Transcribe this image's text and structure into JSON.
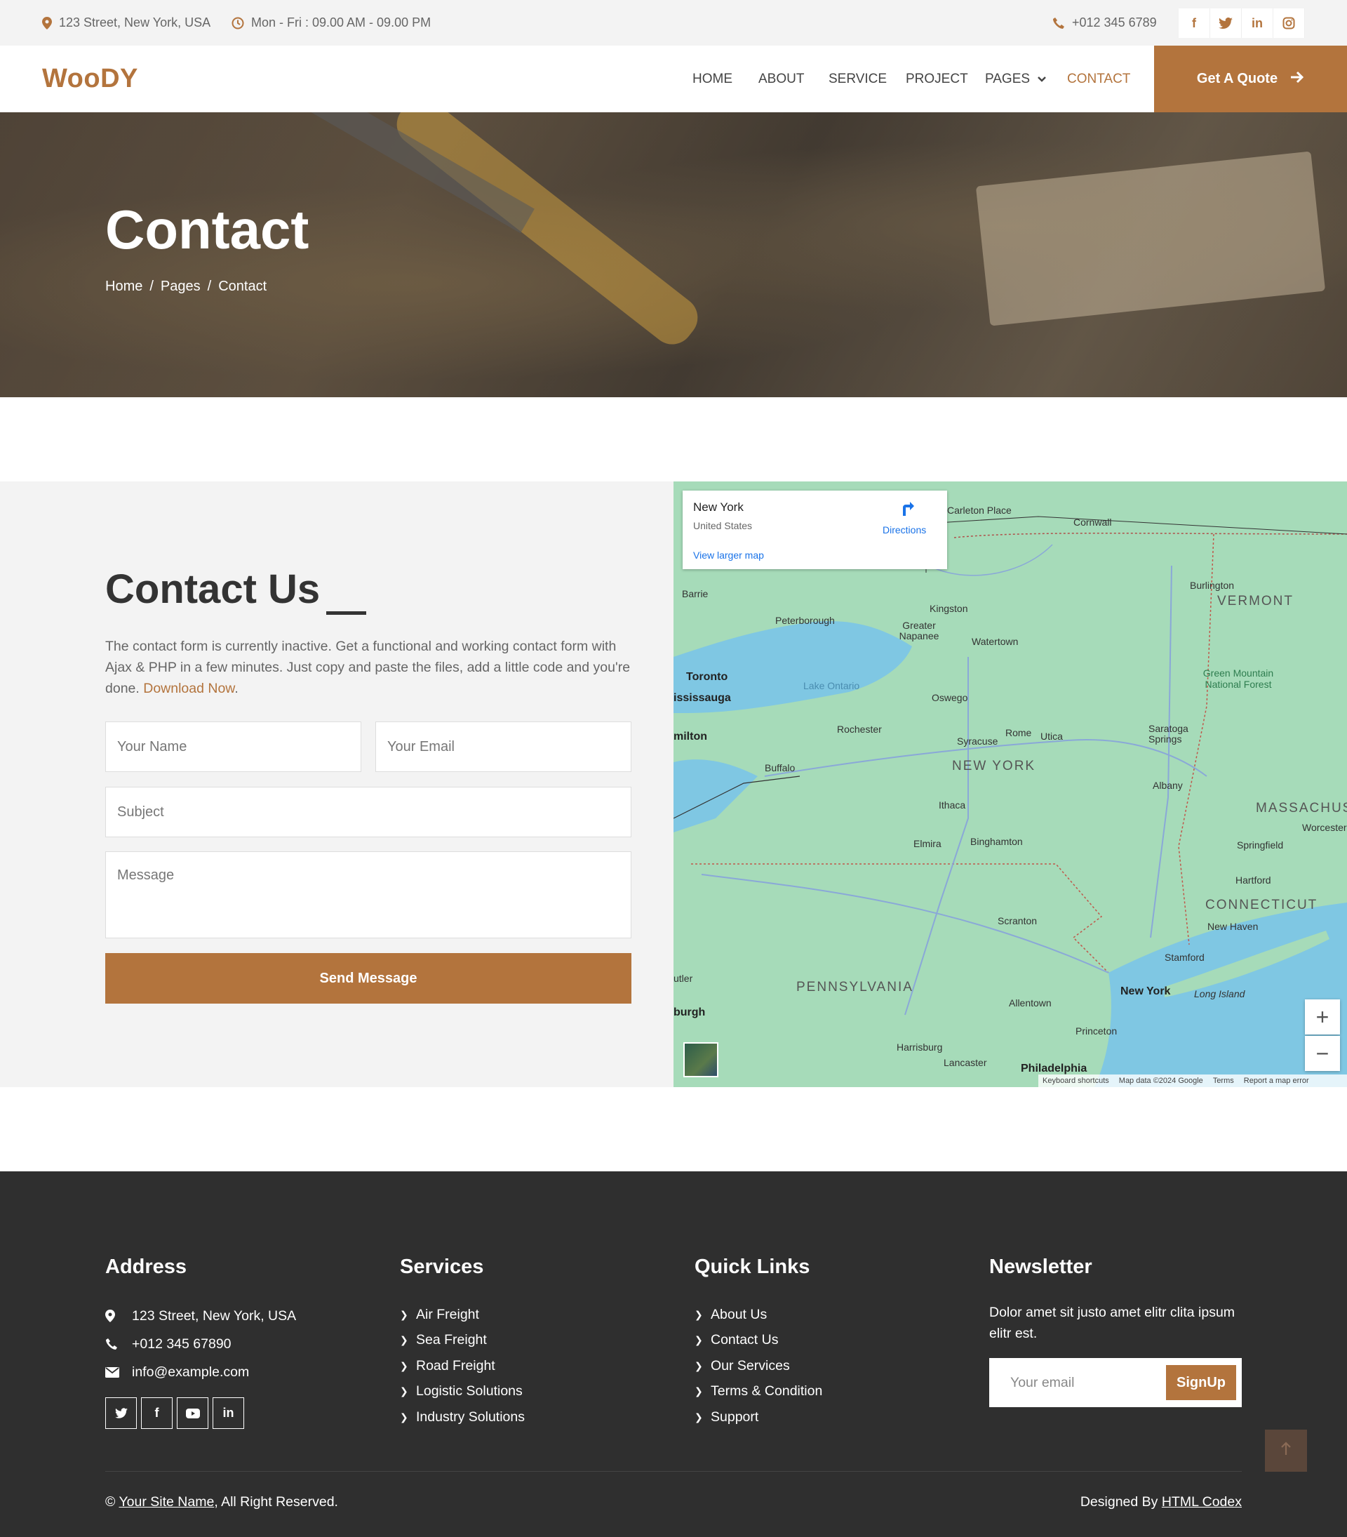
{
  "topbar": {
    "address": "123 Street, New York, USA",
    "hours": "Mon - Fri : 09.00 AM - 09.00 PM",
    "phone": "+012 345 6789",
    "social": [
      "f",
      "t",
      "in",
      "ig"
    ]
  },
  "navbar": {
    "brand": "WooDY",
    "items": [
      {
        "label": "HOME"
      },
      {
        "label": "ABOUT"
      },
      {
        "label": "SERVICE"
      },
      {
        "label": "PROJECT"
      },
      {
        "label": "PAGES"
      },
      {
        "label": "CONTACT",
        "active": true
      }
    ],
    "quote_label": "Get A Quote"
  },
  "hero": {
    "title": "Contact",
    "breadcrumb": [
      "Home",
      "Pages",
      "Contact"
    ],
    "separator": "/"
  },
  "contact": {
    "title": "Contact Us",
    "text": "The contact form is currently inactive. Get a functional and working contact form with Ajax & PHP in a few minutes. Just copy and paste the files, add a little code and you're done.",
    "link": "Download Now",
    "text_end": ".",
    "fields": {
      "name": "Your Name",
      "email": "Your Email",
      "subject": "Subject",
      "message": "Message"
    },
    "send_label": "Send Message"
  },
  "map": {
    "card": {
      "title": "New York",
      "subtitle": "United States",
      "directions": "Directions",
      "larger": "View larger map"
    },
    "labels": {
      "vermont": "VERMONT",
      "new_york_state": "NEW YORK",
      "pennsylvania": "PENNSYLVANIA",
      "massachusetts": "MASSACHUS",
      "connecticut": "CONNECTICUT",
      "toronto": "Toronto",
      "mississauga": "ississauga",
      "hamilton": "milton",
      "buffalo": "Buffalo",
      "rochester": "Rochester",
      "syracuse": "Syracuse",
      "albany": "Albany",
      "kingston": "Kingston",
      "ithaca": "Ithaca",
      "binghamton": "Binghamton",
      "elmira": "Elmira",
      "scranton": "Scranton",
      "allentown": "Allentown",
      "harrisburg": "Harrisburg",
      "philadelphia": "Philadelphia",
      "newyork": "New York",
      "hartford": "Hartford",
      "springfield": "Springfield",
      "newhaven": "New Haven",
      "stamford": "Stamford",
      "princeton": "Princeton",
      "lancaster": "Lancaster",
      "utica": "Utica",
      "rome": "Rome",
      "oswego": "Oswego",
      "watertown": "Watertown",
      "burlington": "Burlington",
      "barrie": "Barrie",
      "peterborough": "Peterborough",
      "cornwall": "Cornwall",
      "carleton": "Carleton Place",
      "saratoga": "Saratoga Springs",
      "longisland": "Long Island",
      "lake_ontario": "Lake Ontario",
      "greater_napanee": "Greater Napanee",
      "green_mountain": "Green Mountain National Forest",
      "pittsburgh": "burgh",
      "butler": "utler",
      "worcester": "Worcester"
    },
    "zoom_in": "+",
    "zoom_out": "−",
    "footer": [
      "Keyboard shortcuts",
      "Map data ©2024 Google",
      "Terms",
      "Report a map error"
    ]
  },
  "footer": {
    "address": {
      "title": "Address",
      "street": "123 Street, New York, USA",
      "phone": "+012 345 67890",
      "email": "info@example.com"
    },
    "services": {
      "title": "Services",
      "items": [
        "Air Freight",
        "Sea Freight",
        "Road Freight",
        "Logistic Solutions",
        "Industry Solutions"
      ]
    },
    "quick_links": {
      "title": "Quick Links",
      "items": [
        "About Us",
        "Contact Us",
        "Our Services",
        "Terms & Condition",
        "Support"
      ]
    },
    "newsletter": {
      "title": "Newsletter",
      "text": "Dolor amet sit justo amet elitr clita ipsum elitr est.",
      "placeholder": "Your email",
      "button": "SignUp"
    },
    "copyright_prefix": "©",
    "site_name": "Your Site Name",
    "copyright_suffix": ", All Right Reserved.",
    "designed_prefix": "Designed By",
    "designer": "HTML Codex"
  },
  "colors": {
    "accent": "#b3743d",
    "footer_bg": "#2f2f2f",
    "section_bg": "#f3f3f3",
    "map_land": "#a6dbb9",
    "map_water": "#7fc7e3"
  }
}
